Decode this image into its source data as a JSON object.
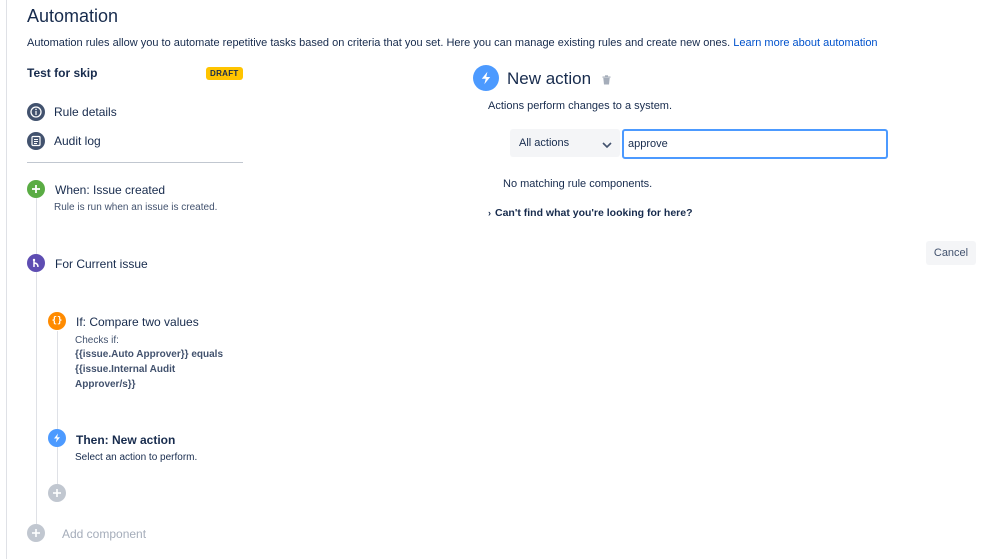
{
  "header": {
    "title": "Automation",
    "description": "Automation rules allow you to automate repetitive tasks based on criteria that you set. Here you can manage existing rules and create new ones.",
    "learn_more": "Learn more about automation"
  },
  "rule": {
    "name": "Test for skip",
    "status": "DRAFT"
  },
  "nav": [
    {
      "label": "Rule details",
      "icon": "info-icon"
    },
    {
      "label": "Audit log",
      "icon": "log-icon"
    }
  ],
  "steps": {
    "trigger": {
      "title": "When: Issue created",
      "subtitle": "Rule is run when an issue is created."
    },
    "branch": {
      "title": "For Current issue"
    },
    "condition": {
      "title": "If: Compare two values",
      "checks_label": "Checks if:",
      "line1": "{{issue.Auto Approver}} equals",
      "line2": "{{issue.Internal Audit",
      "line3": "Approver/s}}"
    },
    "action": {
      "title": "Then: New action",
      "subtitle": "Select an action to perform."
    }
  },
  "add_component": "Add component",
  "panel": {
    "title": "New action",
    "description": "Actions perform changes to a system.",
    "filter_selected": "All actions",
    "search_value": "approve",
    "empty_message": "No matching rule components.",
    "expander": "Can't find what you're looking for here?",
    "cancel": "Cancel"
  },
  "colors": {
    "trigger": "#5aac44",
    "branch": "#5e4db2",
    "condition": "#ff8b00",
    "action": "#4c9aff",
    "nav_icon": "#42526e",
    "draft_badge": "#ffc400"
  }
}
